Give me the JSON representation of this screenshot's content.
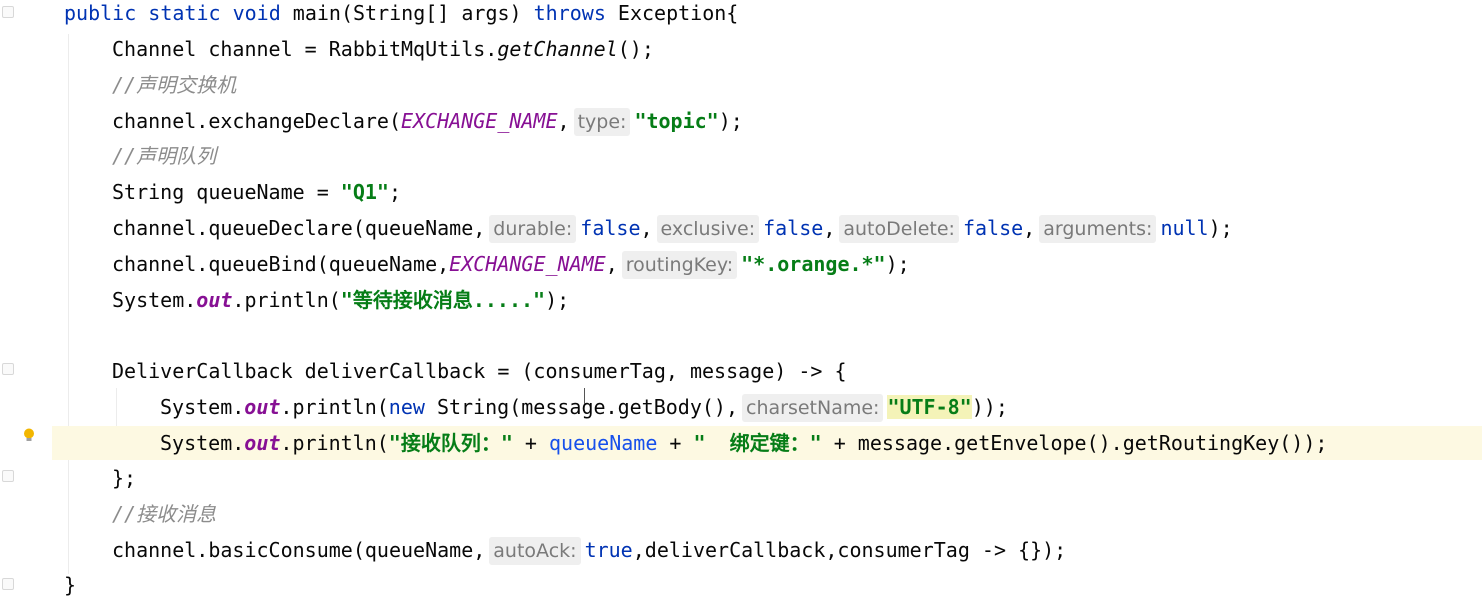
{
  "editor": {
    "lines": [
      {
        "id": "l1",
        "parts": [
          {
            "t": "public static void",
            "c": "kw"
          },
          {
            "t": " main(String[] args) "
          },
          {
            "t": "throws",
            "c": "kw"
          },
          {
            "t": " Exception{"
          }
        ]
      },
      {
        "id": "l2",
        "parts": [
          {
            "t": "Channel channel = RabbitMqUtils."
          },
          {
            "t": "getChannel",
            "c": "static-m"
          },
          {
            "t": "();"
          }
        ]
      },
      {
        "id": "l3",
        "parts": [
          {
            "t": "//声明交换机",
            "c": "cmt"
          }
        ]
      },
      {
        "id": "l4",
        "parts": [
          {
            "t": "channel.exchangeDeclare("
          },
          {
            "t": "EXCHANGE_NAME",
            "c": "italic-const"
          },
          {
            "t": ","
          },
          {
            "t": "type:",
            "c": "hint"
          },
          {
            "t": "\"topic\"",
            "c": "str"
          },
          {
            "t": ");"
          }
        ]
      },
      {
        "id": "l5",
        "parts": [
          {
            "t": "//声明队列",
            "c": "cmt"
          }
        ]
      },
      {
        "id": "l6",
        "parts": [
          {
            "t": "String queueName = "
          },
          {
            "t": "\"Q1\"",
            "c": "str"
          },
          {
            "t": ";"
          }
        ]
      },
      {
        "id": "l7",
        "parts": [
          {
            "t": "channel.queueDeclare(queueName,"
          },
          {
            "t": "durable:",
            "c": "hint"
          },
          {
            "t": "false",
            "c": "kw"
          },
          {
            "t": ","
          },
          {
            "t": "exclusive:",
            "c": "hint"
          },
          {
            "t": "false",
            "c": "kw"
          },
          {
            "t": ","
          },
          {
            "t": "autoDelete:",
            "c": "hint"
          },
          {
            "t": "false",
            "c": "kw"
          },
          {
            "t": ","
          },
          {
            "t": "arguments:",
            "c": "hint"
          },
          {
            "t": "null",
            "c": "kw"
          },
          {
            "t": ");"
          }
        ]
      },
      {
        "id": "l8",
        "parts": [
          {
            "t": "channel.queueBind(queueName,"
          },
          {
            "t": "EXCHANGE_NAME",
            "c": "italic-const"
          },
          {
            "t": ","
          },
          {
            "t": "routingKey:",
            "c": "hint"
          },
          {
            "t": "\"*.orange.*\"",
            "c": "str"
          },
          {
            "t": ");"
          }
        ]
      },
      {
        "id": "l9",
        "parts": [
          {
            "t": "System."
          },
          {
            "t": "out",
            "c": "static-f"
          },
          {
            "t": ".println("
          },
          {
            "t": "\"等待接收消息.....\"",
            "c": "str"
          },
          {
            "t": ");"
          }
        ]
      },
      {
        "id": "l10",
        "parts": []
      },
      {
        "id": "l11",
        "parts": [
          {
            "t": "DeliverCallback deliverCallback = (consumerTag, message) -> {"
          }
        ]
      },
      {
        "id": "l12",
        "parts": [
          {
            "t": "System."
          },
          {
            "t": "out",
            "c": "static-f"
          },
          {
            "t": ".println("
          },
          {
            "t": "new",
            "c": "kw"
          },
          {
            "t": " String(message.getBody(),"
          },
          {
            "t": "charsetName:",
            "c": "hint"
          },
          {
            "t": "\"UTF-8\"",
            "c": "str hl-str"
          },
          {
            "t": "));"
          }
        ]
      },
      {
        "id": "l13",
        "parts": [
          {
            "t": "System."
          },
          {
            "t": "out",
            "c": "static-f"
          },
          {
            "t": ".println("
          },
          {
            "t": "\"接收队列：\"",
            "c": "str"
          },
          {
            "t": " + "
          },
          {
            "t": "queueName",
            "c": "param"
          },
          {
            "t": " + "
          },
          {
            "t": "\"  绑定键：\"",
            "c": "str"
          },
          {
            "t": " + message.getEnvelope().getRoutingKey());"
          }
        ]
      },
      {
        "id": "l14",
        "parts": [
          {
            "t": "};"
          }
        ]
      },
      {
        "id": "l15",
        "parts": [
          {
            "t": "//接收消息",
            "c": "cmt"
          }
        ]
      },
      {
        "id": "l16",
        "parts": [
          {
            "t": "channel.basicConsume(queueName,"
          },
          {
            "t": "autoAck:",
            "c": "hint"
          },
          {
            "t": "true",
            "c": "kw"
          },
          {
            "t": ",deliverCallback,consumerTag -> {});"
          }
        ]
      },
      {
        "id": "l17",
        "parts": [
          {
            "t": "}"
          }
        ]
      }
    ]
  },
  "colors": {
    "keyword": "#0033b3",
    "string": "#067d17",
    "constant": "#871094",
    "comment": "#8c8c8c",
    "current_line": "#fdf9e2"
  },
  "icons": {
    "intention_bulb": "lightbulb-icon"
  }
}
